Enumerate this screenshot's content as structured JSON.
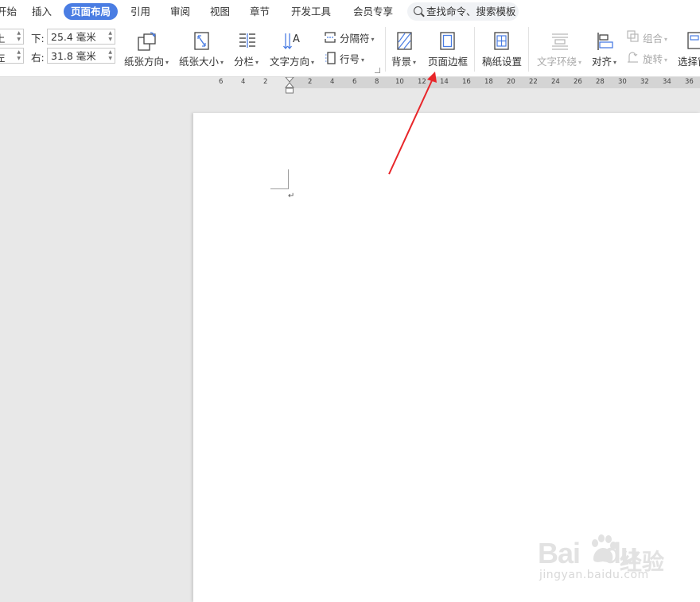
{
  "menu": {
    "tabs": [
      "开始",
      "插入",
      "页面布局",
      "引用",
      "审阅",
      "视图",
      "章节",
      "开发工具",
      "会员专享"
    ],
    "active_tab": "页面布局",
    "search": {
      "placeholder": "查找命令、搜索模板",
      "icon": "search-icon"
    }
  },
  "ribbon": {
    "margins": {
      "bottom_label": "下:",
      "bottom_value": "25.4 毫米",
      "right_label": "右:",
      "right_value": "31.8 毫米"
    },
    "buttons": {
      "orientation": "纸张方向",
      "paper_size": "纸张大小",
      "columns": "分栏",
      "text_direction": "文字方向",
      "breaks": "分隔符",
      "line_numbers": "行号",
      "background": "背景",
      "page_borders": "页面边框",
      "manuscript": "稿纸设置",
      "text_wrap": "文字环绕",
      "align": "对齐",
      "group": "组合",
      "rotate": "旋转",
      "selection_pane": "选择窗"
    }
  },
  "ruler": {
    "left_numbers": [
      "6",
      "4",
      "2"
    ],
    "right_numbers": [
      "2",
      "4",
      "6",
      "8",
      "10",
      "12",
      "14",
      "16",
      "18",
      "20",
      "22",
      "24",
      "26",
      "28",
      "30",
      "32",
      "34",
      "36"
    ]
  },
  "document": {
    "paragraph_mark": "↵"
  },
  "watermark": {
    "brand": "Bai",
    "brand_suffix": "du",
    "cn_text": "经验",
    "url": "jingyan.baidu.com"
  },
  "annotation": {
    "arrow_color": "#e8262a"
  },
  "colors": {
    "accent": "#4a7de3",
    "arrow": "#e8262a"
  }
}
